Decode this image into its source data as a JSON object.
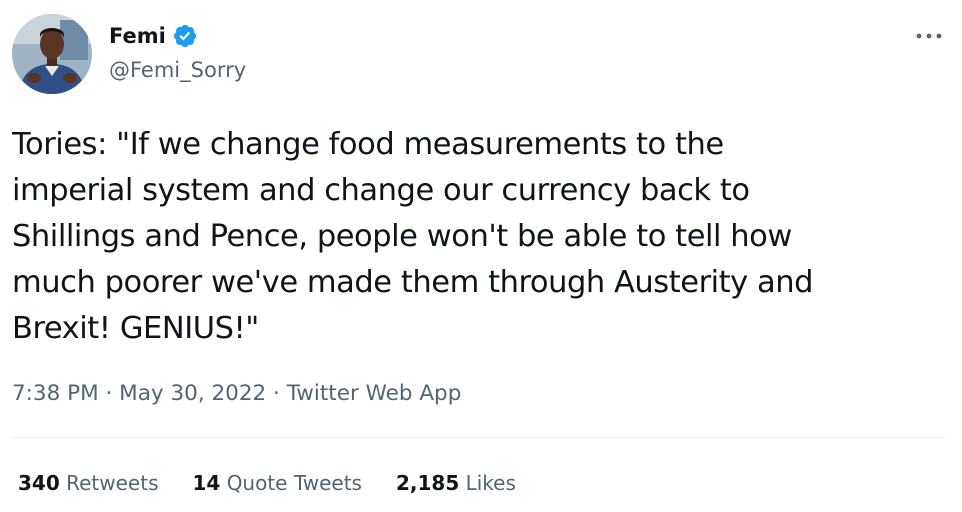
{
  "user": {
    "display_name": "Femi",
    "handle": "@Femi_Sorry",
    "verified": true,
    "verified_color": "#1d9bf0"
  },
  "tweet": {
    "text": "Tories: \"If we change food measurements to the\nimperial system and change our currency back to\nShillings and Pence, people won't be able to tell how\nmuch poorer we've made them through Austerity and\nBrexit! GENIUS!\"",
    "time": "7:38 PM",
    "separator": "·",
    "date": "May 30, 2022",
    "source": "Twitter Web App"
  },
  "stats": {
    "retweets_count": "340",
    "retweets_label": "Retweets",
    "quotes_count": "14",
    "quotes_label": "Quote Tweets",
    "likes_count": "2,185",
    "likes_label": "Likes"
  },
  "icons": {
    "verified": "verified-badge-icon",
    "more": "more-options-icon"
  },
  "colors": {
    "text_primary": "#0f1419",
    "text_secondary": "#536471",
    "divider": "#eff3f4",
    "accent": "#1d9bf0"
  }
}
